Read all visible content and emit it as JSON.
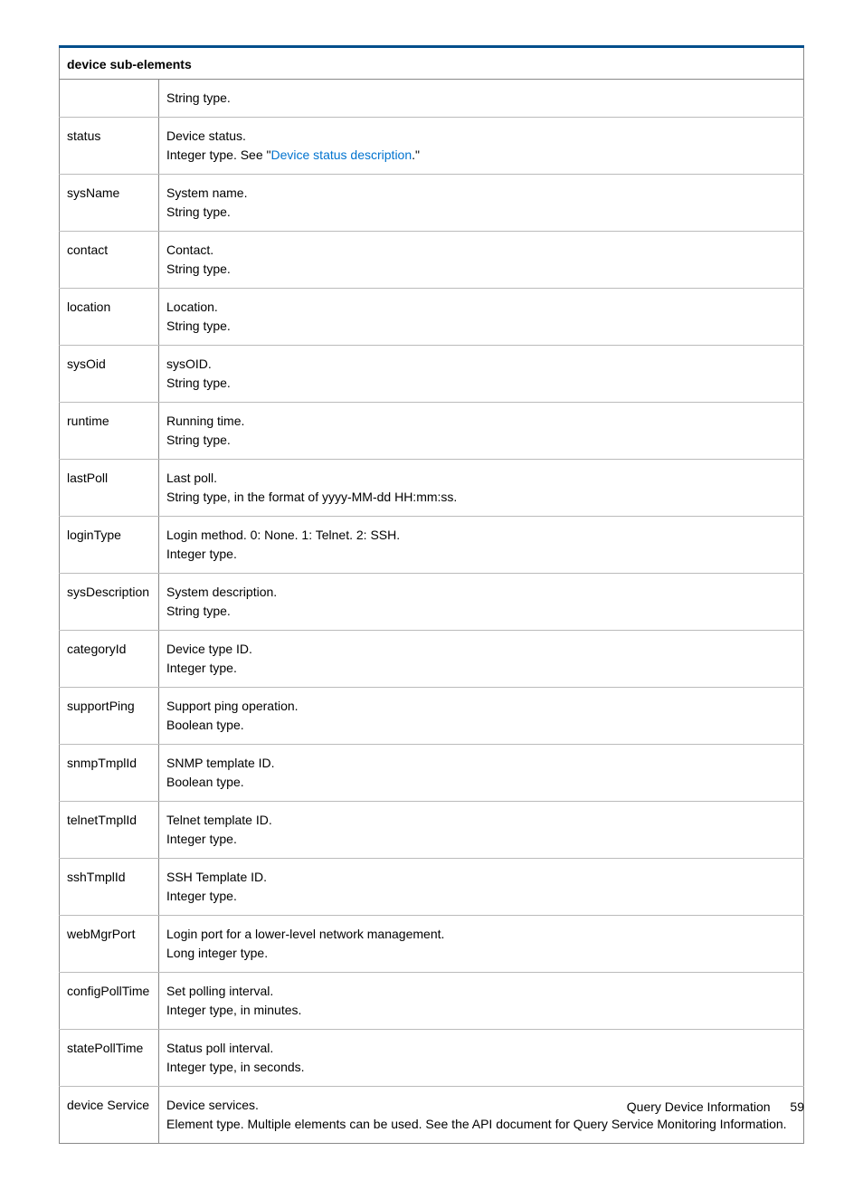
{
  "table": {
    "header": "device sub-elements",
    "rows": [
      {
        "name": "",
        "lines": [
          "String type."
        ]
      },
      {
        "name": "status",
        "lines": [
          "Device status.",
          "Integer type. See \"",
          "Device status description",
          ".\""
        ],
        "link_index": 2
      },
      {
        "name": "sysName",
        "lines": [
          "System name.",
          "String type."
        ]
      },
      {
        "name": "contact",
        "lines": [
          "Contact.",
          "String type."
        ]
      },
      {
        "name": "location",
        "lines": [
          "Location.",
          "String type."
        ]
      },
      {
        "name": "sysOid",
        "lines": [
          "sysOID.",
          "String type."
        ]
      },
      {
        "name": "runtime",
        "lines": [
          "Running time.",
          "String type."
        ]
      },
      {
        "name": "lastPoll",
        "lines": [
          "Last poll.",
          "String type, in the format of yyyy-MM-dd HH:mm:ss."
        ]
      },
      {
        "name": "loginType",
        "lines": [
          "Login method. 0: None. 1: Telnet. 2: SSH.",
          "Integer type."
        ]
      },
      {
        "name": "sysDescription",
        "lines": [
          "System description.",
          "String type."
        ]
      },
      {
        "name": "categoryId",
        "lines": [
          "Device type ID.",
          "Integer type."
        ]
      },
      {
        "name": "supportPing",
        "lines": [
          "Support ping operation.",
          "Boolean type."
        ]
      },
      {
        "name": "snmpTmplId",
        "lines": [
          "SNMP template ID.",
          "Boolean type."
        ]
      },
      {
        "name": "telnetTmplId",
        "lines": [
          "Telnet template ID.",
          "Integer type."
        ]
      },
      {
        "name": "sshTmplId",
        "lines": [
          "SSH Template ID.",
          "Integer type."
        ]
      },
      {
        "name": "webMgrPort",
        "lines": [
          "Login port for a lower-level network management.",
          "Long integer type."
        ]
      },
      {
        "name": "configPollTime",
        "lines": [
          "Set polling interval.",
          "Integer type, in minutes."
        ]
      },
      {
        "name": "statePollTime",
        "lines": [
          "Status poll interval.",
          "Integer type, in seconds."
        ]
      },
      {
        "name": "device Service",
        "lines": [
          "Device services.",
          "Element type. Multiple elements can be used. See the API document for Query Service Monitoring Information."
        ]
      }
    ]
  },
  "footer": {
    "title": "Query Device Information",
    "page": "59"
  }
}
